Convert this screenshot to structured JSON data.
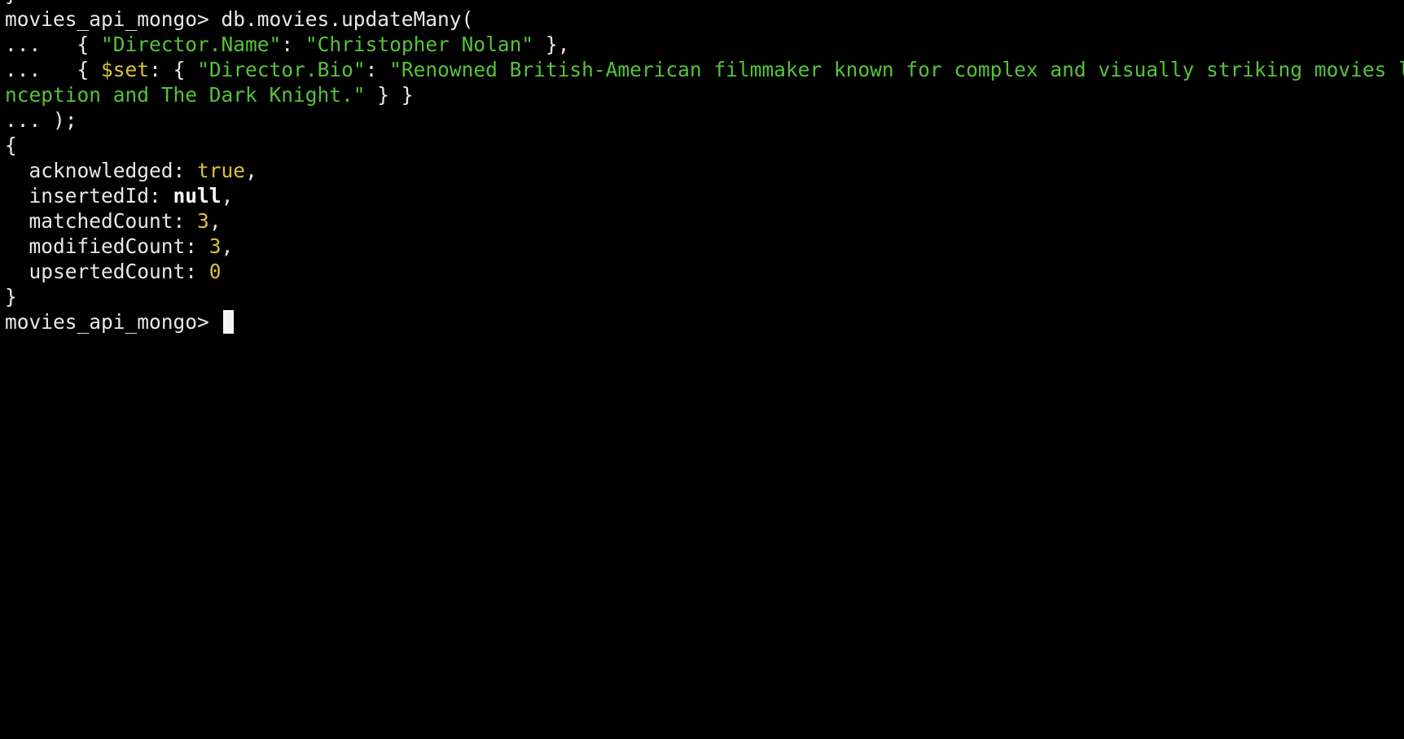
{
  "terminal": {
    "prev_line_tail": "}",
    "prompt": "movies_api_mongo>",
    "command": "db.movies.updateMany(",
    "continuation": "...",
    "filter": {
      "open": "{ ",
      "key": "\"Director.Name\"",
      "sep": ": ",
      "value": "\"Christopher Nolan\"",
      "close": " },"
    },
    "update": {
      "open": "{ ",
      "operator": "$set",
      "sep1": ": { ",
      "key": "\"Director.Bio\"",
      "sep2": ": ",
      "value_part1": "\"Renowned British-American filmmaker known for complex and visually striking movies like I",
      "value_part2": "nception and The Dark Knight.\"",
      "close": " } }"
    },
    "call_close": " );",
    "result": {
      "open_brace": "{",
      "fields": [
        {
          "key": "acknowledged",
          "value": "true",
          "type": "bool",
          "suffix": ","
        },
        {
          "key": "insertedId",
          "value": "null",
          "type": "null",
          "suffix": ","
        },
        {
          "key": "matchedCount",
          "value": "3",
          "type": "num",
          "suffix": ","
        },
        {
          "key": "modifiedCount",
          "value": "3",
          "type": "num",
          "suffix": ","
        },
        {
          "key": "upsertedCount",
          "value": "0",
          "type": "num",
          "suffix": ""
        }
      ],
      "close_brace": "}"
    },
    "final_prompt": "movies_api_mongo>"
  },
  "colors": {
    "background": "#000000",
    "text": "#e8e8e8",
    "string": "#55c23a",
    "literal": "#d8c23c",
    "cursor": "#f5f5f5"
  }
}
